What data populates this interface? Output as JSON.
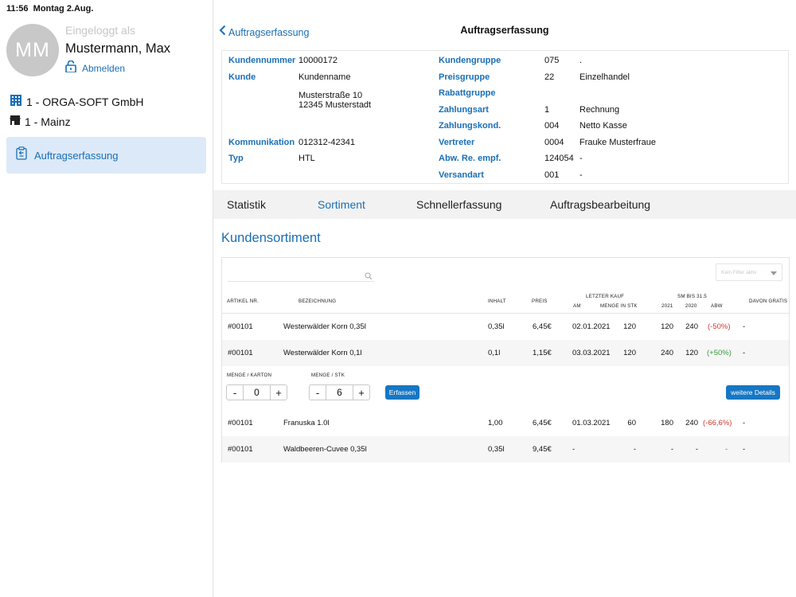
{
  "status_bar": {
    "time": "11:56",
    "date": "Montag 2.Aug."
  },
  "sidebar": {
    "avatar_initials": "MM",
    "logged_in_label": "Eingeloggt als",
    "user_name": "Mustermann, Max",
    "logout_label": "Abmelden",
    "company": "1 - ORGA-SOFT GmbH",
    "branch": "1 -  Mainz",
    "nav_item_label": "Auftragserfassung"
  },
  "header": {
    "back_label": "Auftragserfassung",
    "title": "Auftragserfassung"
  },
  "customer": {
    "kundennummer_label": "Kundennummer",
    "kundennummer": "10000172",
    "kunde_label": "Kunde",
    "kunde_name": "Kundenname",
    "street": "Musterstraße 10",
    "city": "12345 Musterstadt",
    "kommunikation_label": "Kommunikation",
    "kommunikation": "012312-42341",
    "typ_label": "Typ",
    "typ": "HTL",
    "kundengruppe_label": "Kundengruppe",
    "kundengruppe_code": "075",
    "kundengruppe_text": ".",
    "preisgruppe_label": "Preisgruppe",
    "preisgruppe_code": "22",
    "preisgruppe_text": "Einzelhandel",
    "rabattgruppe_label": "Rabattgruppe",
    "zahlungsart_label": "Zahlungsart",
    "zahlungsart_code": "1",
    "zahlungsart_text": "Rechnung",
    "zahlungskond_label": "Zahlungskond.",
    "zahlungskond_code": "004",
    "zahlungskond_text": "Netto Kasse",
    "vertreter_label": "Vertreter",
    "vertreter_code": "0004",
    "vertreter_text": "Frauke Musterfraue",
    "abw_label": "Abw. Re. empf.",
    "abw_code": "124054",
    "abw_text": "-",
    "versandart_label": "Versandart",
    "versandart_code": "001",
    "versandart_text": "-"
  },
  "tabs": [
    "Statistik",
    "Sortiment",
    "Schnellerfassung",
    "Auftragsbearbeitung"
  ],
  "active_tab": "Sortiment",
  "section_title": "Kundensortiment",
  "search": {
    "placeholder": ""
  },
  "filter": {
    "placeholder": "Kein Filter aktiv"
  },
  "table_headers": {
    "artikel_nr": "ARTIKEL NR.",
    "bezeichnung": "BEZEICHNUNG",
    "inhalt": "INHALT",
    "preis": "PREIS",
    "letzter_kauf": "LETZTER KAUF",
    "am": "AM",
    "menge_in_stk": "MENGE IN STK",
    "sm_bis": "SM BIS 31.5",
    "y2021": "2021",
    "y2020": "2020",
    "abw": "ABW",
    "davon_gratis": "DAVON GRATIS"
  },
  "rows": [
    {
      "artikel": "#00101",
      "bezeichnung": "Westerwälder Korn 0,35l",
      "inhalt": "0,35l",
      "preis": "6,45€",
      "am": "02.01.2021",
      "menge": "120",
      "y2021": "120",
      "y2020": "240",
      "abw": "(-50%)",
      "gratis": "-"
    },
    {
      "artikel": "#00101",
      "bezeichnung": "Westerwälder Korn 0,1l",
      "inhalt": "0,1l",
      "preis": "1,15€",
      "am": "03.03.2021",
      "menge": "120",
      "y2021": "240",
      "y2020": "120",
      "abw": "(+50%)",
      "gratis": "-"
    },
    {
      "artikel": "#00101",
      "bezeichnung": "Franuska 1.0l",
      "inhalt": "1,00",
      "preis": "6,45€",
      "am": "01.03.2021",
      "menge": "60",
      "y2021": "180",
      "y2020": "240",
      "abw": "(-66,6%)",
      "gratis": "-"
    },
    {
      "artikel": "#00101",
      "bezeichnung": "Waldbeeren-Cuvee 0,35l",
      "inhalt": "0,35l",
      "preis": "9,45€",
      "am": "-",
      "menge": "-",
      "y2021": "-",
      "y2020": "-",
      "abw": "-",
      "gratis": "-"
    }
  ],
  "detail": {
    "menge_karton_label": "MENGE / KARTON",
    "menge_karton_value": "0",
    "menge_stk_label": "MENGE / STK",
    "menge_stk_value": "6",
    "minus": "-",
    "plus": "+",
    "erfassen_label": "Erfassen",
    "weitere_details_label": "weitere Details"
  },
  "colors": {
    "accent": "#1a6fb5",
    "negative": "#d23a30",
    "positive": "#3a9a3a",
    "selected_bg": "#dce9f8"
  }
}
